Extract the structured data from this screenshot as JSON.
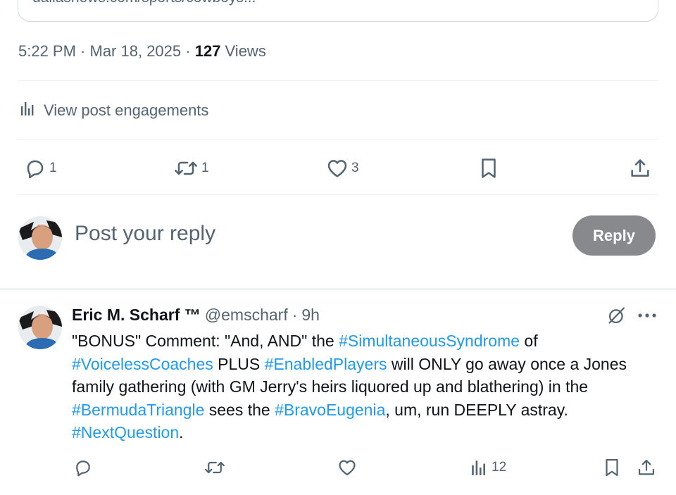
{
  "link_card": {
    "url": "dallasnews.com/sports/cowboys..."
  },
  "meta": {
    "time": "5:22 PM",
    "sep1": " · ",
    "date": "Mar 18, 2025",
    "sep2": " · ",
    "views_count": "127",
    "views_label": " Views"
  },
  "engagements": {
    "label": "View post engagements",
    "icon": "analytics-icon"
  },
  "main_actions": {
    "replies": "1",
    "reposts": "1",
    "likes": "3"
  },
  "composer": {
    "placeholder": "Post your reply",
    "reply_button": "Reply"
  },
  "reply_post": {
    "author_name": "Eric M. Scharf ™",
    "handle": "@emscharf",
    "separator": "·",
    "time": "9h",
    "body": [
      {
        "t": "text",
        "v": "\"BONUS\" Comment: \"And, AND\" the "
      },
      {
        "t": "tag",
        "v": "#SimultaneousSyndrome"
      },
      {
        "t": "text",
        "v": " of "
      },
      {
        "t": "tag",
        "v": "#VoicelessCoaches"
      },
      {
        "t": "text",
        "v": " PLUS "
      },
      {
        "t": "tag",
        "v": "#EnabledPlayers"
      },
      {
        "t": "text",
        "v": " will ONLY go away once a Jones family gathering (with GM Jerry's heirs liquored up and blathering) in the "
      },
      {
        "t": "tag",
        "v": "#BermudaTriangle"
      },
      {
        "t": "text",
        "v": " sees the "
      },
      {
        "t": "tag",
        "v": "#BravoEugenia"
      },
      {
        "t": "text",
        "v": ", um, run DEEPLY astray. "
      },
      {
        "t": "tag",
        "v": "#NextQuestion"
      },
      {
        "t": "text",
        "v": "."
      }
    ],
    "views": "12"
  },
  "colors": {
    "link": "#1d9bf0",
    "secondary_text": "#536471",
    "reply_button_bg": "#87898c"
  }
}
